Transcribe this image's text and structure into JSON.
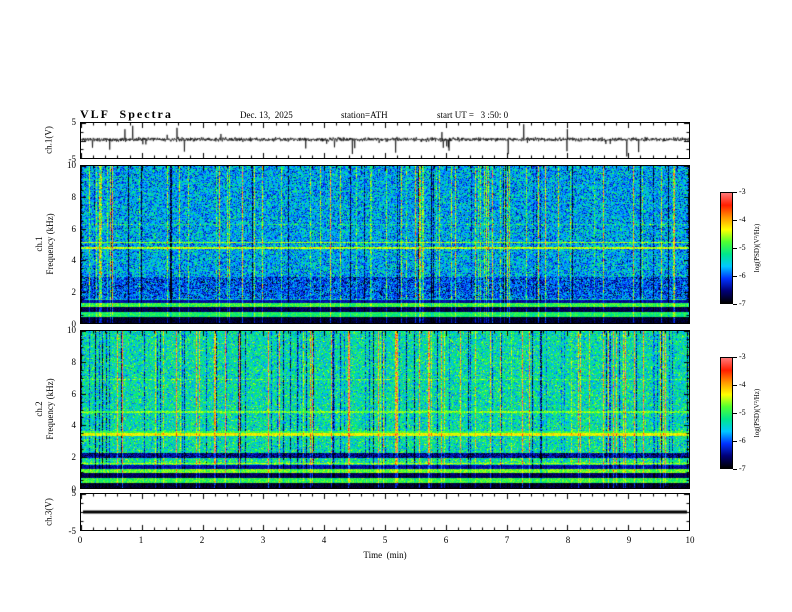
{
  "figure": {
    "title": "VLF  Spectra",
    "header": {
      "date": "Dec. 13,  2025",
      "station": "station=ATH",
      "start_ut": "start UT =   3 :50: 0"
    },
    "xlabel": "Time  (min)",
    "x_ticks": [
      0,
      1,
      2,
      3,
      4,
      5,
      6,
      7,
      8,
      9,
      10
    ]
  },
  "panels": {
    "waveform_ch1": {
      "ylabel": "ch.1(V)",
      "y_ticks": [
        5,
        -5
      ],
      "ylim": [
        -5,
        5
      ],
      "line_color": "#000000"
    },
    "spec_ch1": {
      "ylabel_line1": "ch.1",
      "ylabel_line2": "Frequency  (kHz)",
      "y_ticks": [
        0,
        2,
        4,
        6,
        8,
        10
      ],
      "ylim": [
        0,
        10
      ]
    },
    "spec_ch2": {
      "ylabel_line1": "ch.2",
      "ylabel_line2": "Frequency  (kHz)",
      "y_ticks": [
        0,
        2,
        4,
        6,
        8,
        10
      ],
      "ylim": [
        0,
        10
      ]
    },
    "waveform_ch3": {
      "ylabel": "ch.3(V)",
      "y_ticks": [
        5,
        -5
      ],
      "ylim": [
        -5,
        5
      ],
      "constant_value": 0,
      "line_color": "#000000"
    }
  },
  "colorbar": {
    "label": "log(PSD)(V²/Hz)",
    "ticks": [
      -3,
      -4,
      -5,
      -6,
      -7
    ],
    "gradient": [
      "#ff7878",
      "#ff1e00",
      "#ff9600",
      "#ffff00",
      "#50ff32",
      "#00e68c",
      "#00c8ff",
      "#0032ff",
      "#000078",
      "#000000"
    ]
  },
  "chart_data": [
    {
      "type": "line",
      "panel": "ch.1 voltage waveform",
      "xlabel": "Time (min)",
      "xlim": [
        0,
        10
      ],
      "ylabel": "ch.1(V)",
      "ylim": [
        -5,
        5
      ],
      "series": [
        {
          "name": "ch.1 waveform",
          "description": "continuous noisy receiver voltage fluctuating near 0 V with frequent impulsive sferic spikes, mostly downward, reaching about -4 to -5 V"
        }
      ]
    },
    {
      "type": "heatmap",
      "panel": "ch.1 VLF spectrogram",
      "xlabel": "Time (min)",
      "xlim": [
        0,
        10
      ],
      "ylabel": "Frequency (kHz)",
      "ylim": [
        0,
        10
      ],
      "colorbar_label": "log(PSD)(V²/Hz)",
      "zlim": [
        -7,
        -3
      ],
      "description": "blue-green broadband noise (~-5.5 to -6 log PSD) with dense vertical yellow/green sferic streaks spanning 0-10 kHz, a darker blue band near 1.5-3 kHz, alternating black and green horizontal bands below 1.5 kHz, and faint orange horizontal lines near 4.8-5.2 kHz"
    },
    {
      "type": "heatmap",
      "panel": "ch.2 VLF spectrogram",
      "xlabel": "Time (min)",
      "xlim": [
        0,
        10
      ],
      "ylabel": "Frequency (kHz)",
      "ylim": [
        0,
        10
      ],
      "colorbar_label": "log(PSD)(V²/Hz)",
      "zlim": [
        -7,
        -3
      ],
      "description": "greener background (~-5 log PSD) with both yellow and dark-blue vertical streaks, black/green horizontal bands below 1.5 kHz, a dark band near 2 kHz, a strong orange/yellow line near 3.3-3.6 kHz and a fainter line near 4.8 kHz"
    },
    {
      "type": "line",
      "panel": "ch.3 voltage waveform",
      "xlabel": "Time (min)",
      "xlim": [
        0,
        10
      ],
      "ylabel": "ch.3(V)",
      "ylim": [
        -5,
        5
      ],
      "series": [
        {
          "name": "ch.3 waveform",
          "description": "flat constant line at 0 V across the whole record",
          "constant_value": 0
        }
      ]
    }
  ],
  "render": {
    "waveform_ch1": {
      "seed": 11,
      "points": 1800,
      "noise_amp": 0.55,
      "spike_prob": 0.018,
      "spike_amp": 3.6,
      "baseline": 0.3
    },
    "waveform_ch3": {
      "constant_value": 0,
      "thickness": 3
    },
    "spec_ch1": {
      "seed": 101,
      "base": 0.36,
      "noise": 0.3,
      "streak_pos_prob": 0.1,
      "streak_neg_prob": 0.04,
      "low_boost": 0.1,
      "low_boost_from": 0.7,
      "bands": [
        {
          "from": 0.963,
          "to": 1.0,
          "v": 0.03,
          "jitter": 0.06
        },
        {
          "from": 0.933,
          "to": 0.963,
          "v": 0.55,
          "jitter": 0.18
        },
        {
          "from": 0.903,
          "to": 0.933,
          "v": 0.05,
          "jitter": 0.08
        },
        {
          "from": 0.878,
          "to": 0.903,
          "v": 0.6,
          "jitter": 0.18
        },
        {
          "from": 0.853,
          "to": 0.878,
          "v": 0.12,
          "jitter": 0.1
        },
        {
          "from": 0.71,
          "to": 0.85,
          "v": -0.14,
          "mode": "add"
        },
        {
          "from": 0.518,
          "to": 0.53,
          "v": 0.72,
          "jitter": 0.22
        },
        {
          "from": 0.483,
          "to": 0.493,
          "v": 0.68,
          "jitter": 0.22
        },
        {
          "from": 0.37,
          "to": 0.377,
          "v": 0.12,
          "mode": "add"
        }
      ]
    },
    "spec_ch2": {
      "seed": 202,
      "base": 0.48,
      "noise": 0.26,
      "streak_pos_prob": 0.09,
      "streak_neg_prob": 0.1,
      "low_boost": 0.12,
      "low_boost_from": 0.75,
      "bands": [
        {
          "from": 0.968,
          "to": 1.0,
          "v": 0.03,
          "jitter": 0.06
        },
        {
          "from": 0.938,
          "to": 0.968,
          "v": 0.6,
          "jitter": 0.18
        },
        {
          "from": 0.908,
          "to": 0.938,
          "v": 0.06,
          "jitter": 0.08
        },
        {
          "from": 0.883,
          "to": 0.908,
          "v": 0.65,
          "jitter": 0.18
        },
        {
          "from": 0.858,
          "to": 0.883,
          "v": 0.12,
          "jitter": 0.1
        },
        {
          "from": 0.84,
          "to": 0.85,
          "v": 0.7,
          "jitter": 0.18
        },
        {
          "from": 0.782,
          "to": 0.81,
          "v": 0.1,
          "jitter": 0.2
        },
        {
          "from": 0.652,
          "to": 0.668,
          "v": 0.78,
          "jitter": 0.18
        },
        {
          "from": 0.636,
          "to": 0.652,
          "v": 0.6,
          "jitter": 0.18
        },
        {
          "from": 0.512,
          "to": 0.522,
          "v": 0.66,
          "jitter": 0.2
        },
        {
          "from": 0.303,
          "to": 0.31,
          "v": 0.12,
          "mode": "add"
        }
      ]
    }
  }
}
